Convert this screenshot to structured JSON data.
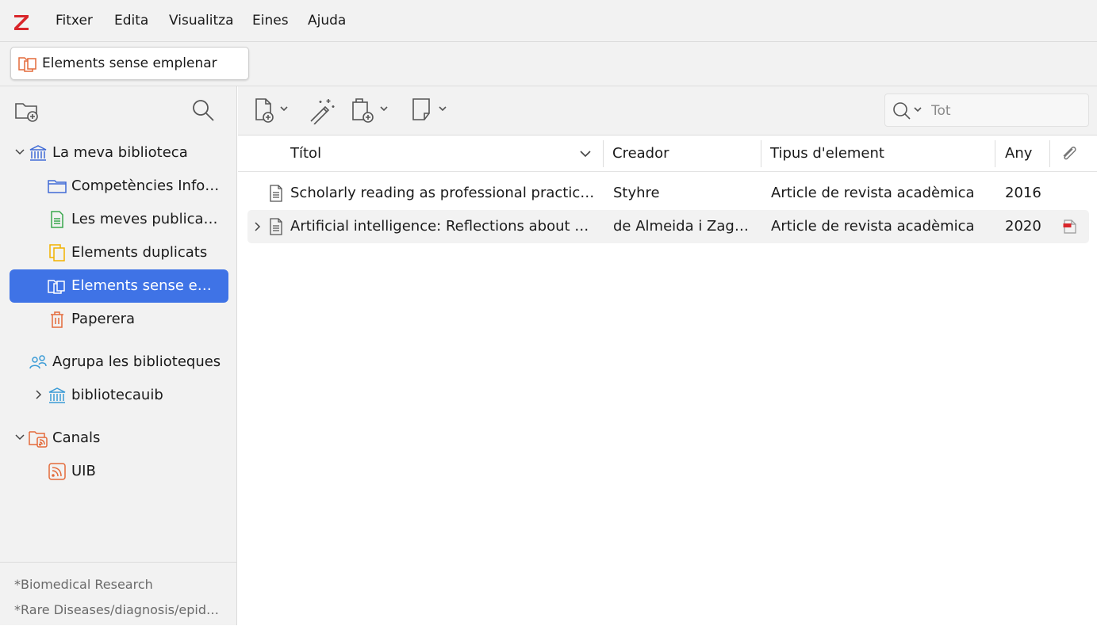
{
  "app": {
    "logo_letter": "Z",
    "brand_color": "#d9262b"
  },
  "menu": [
    "Fitxer",
    "Edita",
    "Visualitza",
    "Eines",
    "Ajuda"
  ],
  "tab": {
    "label": "Elements sense emplenar"
  },
  "sidebar": {
    "tree": [
      {
        "label": "La meva biblioteca",
        "icon": "library-icon",
        "expanded": true
      },
      {
        "label": "Competències Informacionals",
        "icon": "folder-icon"
      },
      {
        "label": "Les meves publicacions",
        "icon": "publications-icon"
      },
      {
        "label": "Elements duplicats",
        "icon": "duplicate-icon"
      },
      {
        "label": "Elements sense emplenar",
        "icon": "unfiled-icon",
        "selected": true
      },
      {
        "label": "Paperera",
        "icon": "trash-icon"
      },
      {
        "label": "Agrupa les biblioteques",
        "icon": "groups-icon"
      },
      {
        "label": "bibliotecauib",
        "icon": "library-icon",
        "expanded": false
      },
      {
        "label": "Canals",
        "icon": "feeds-icon",
        "expanded": true
      },
      {
        "label": "UIB",
        "icon": "feed-icon"
      }
    ],
    "tags": [
      "*Biomedical Research",
      "*Rare Diseases/diagnosis/epidemiology"
    ]
  },
  "search": {
    "placeholder": "Tot",
    "value": ""
  },
  "columns": {
    "title": "Títol",
    "creator": "Creador",
    "type": "Tipus d'element",
    "year": "Any"
  },
  "items": [
    {
      "title": "Scholarly reading as professional practice: a critical review",
      "creator": "Styhre",
      "type": "Article de revista acadèmica",
      "year": "2016",
      "has_attachment": false
    },
    {
      "title": "Artificial intelligence: Reflections about employment",
      "creator": "de Almeida i Zagalo-Melo",
      "type": "Article de revista acadèmica",
      "year": "2020",
      "has_attachment": true
    }
  ],
  "colors": {
    "selection": "#3f73e6",
    "library_blue": "#3f6ad6",
    "feed_orange": "#e36a3a",
    "duplicate_yellow": "#f2b200",
    "publications_green": "#39a74c"
  }
}
